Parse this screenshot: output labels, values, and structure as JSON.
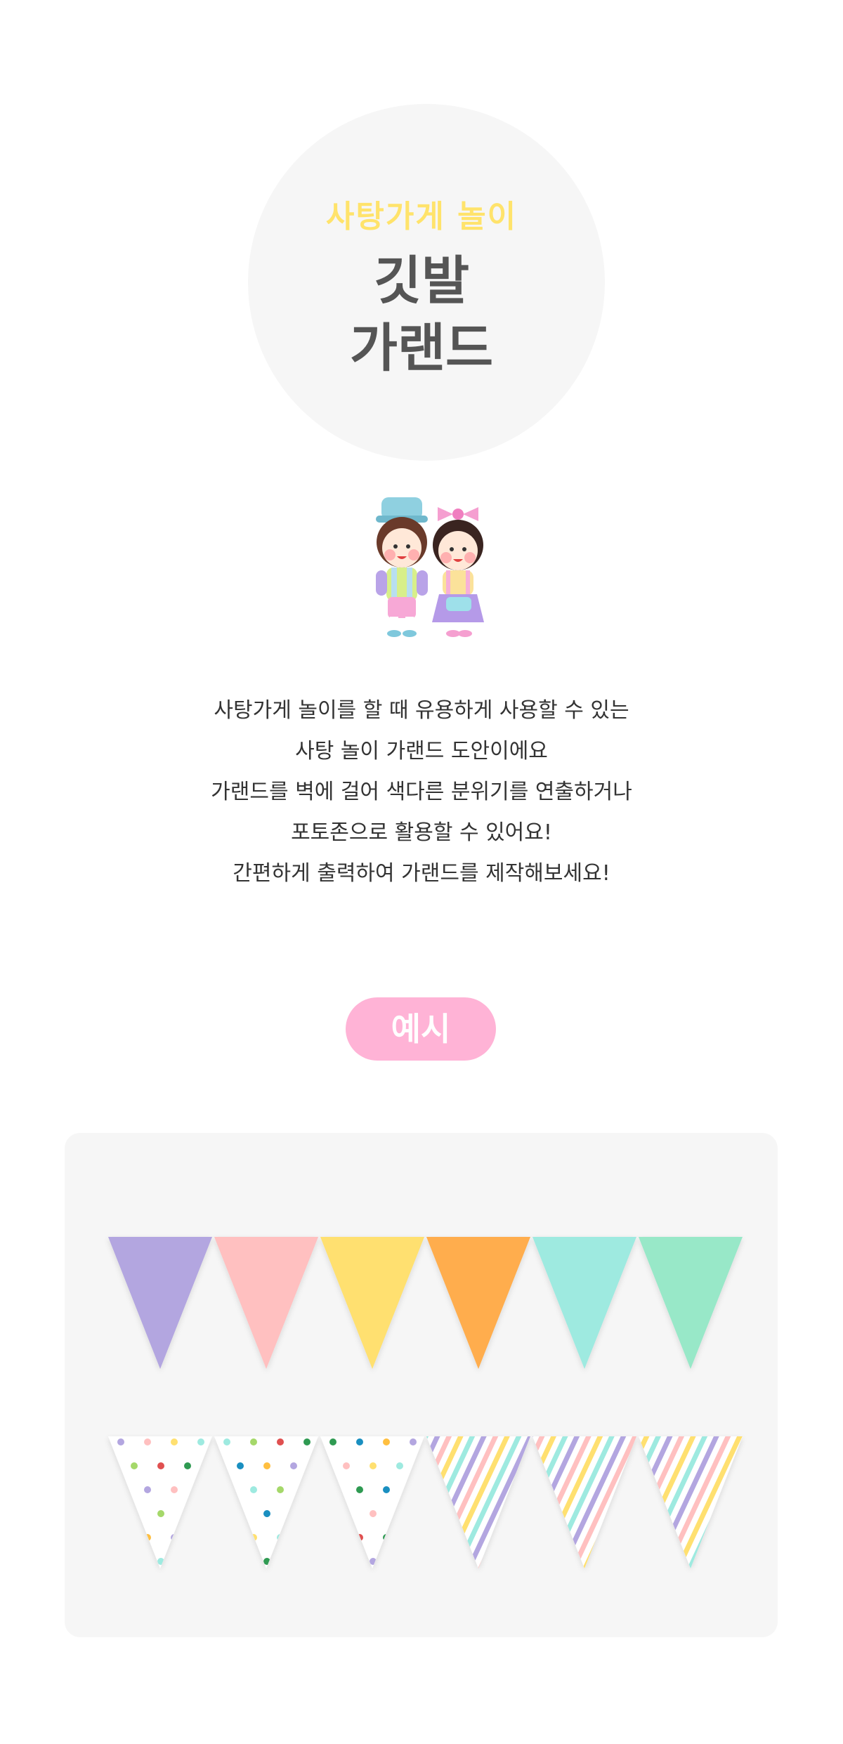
{
  "hero": {
    "subtitle": "사탕가게 놀이",
    "title_line1": "깃발",
    "title_line2": "가랜드"
  },
  "description": [
    "사탕가게 놀이를 할 때 유용하게 사용할 수 있는",
    "사탕 놀이 가랜드 도안이에요",
    "가랜드를 벽에 걸어 색다른 분위기를 연출하거나",
    "포토존으로 활용할 수 있어요!",
    "간편하게 출력하여 가랜드를 제작해보세요!"
  ],
  "example_label": "예시",
  "colors": {
    "subtitle": "#ffe36b",
    "pill": "#ffb3d6",
    "panel": "#f6f6f6"
  },
  "solid_flags": [
    "#b3a6e0",
    "#ffc0c0",
    "#ffe070",
    "#ffad4d",
    "#9eeae0",
    "#98e8c8"
  ],
  "patterned_flags": [
    "dots",
    "dots",
    "dots",
    "stripes",
    "stripes",
    "stripes"
  ],
  "pattern_colors": [
    "#b3a6e0",
    "#ffc0c0",
    "#ffe070",
    "#9eeae0",
    "#a5d86a",
    "#e05050",
    "#2f9a52",
    "#1a8fc0",
    "#ffbf40"
  ]
}
